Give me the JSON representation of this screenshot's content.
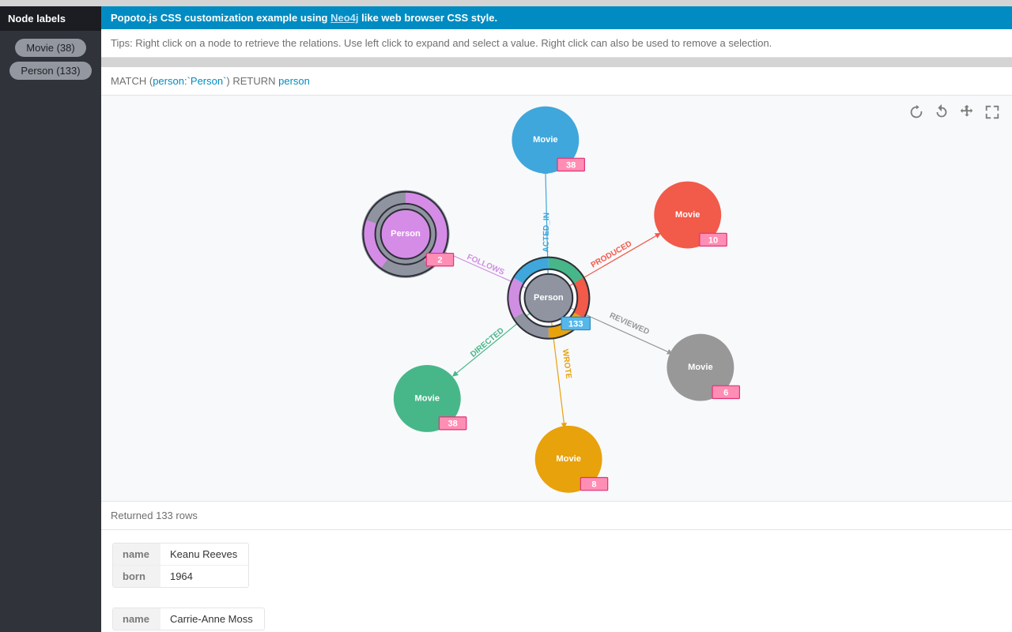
{
  "sidebar": {
    "header": "Node labels",
    "items": [
      {
        "label": "Movie (38)"
      },
      {
        "label": "Person (133)"
      }
    ]
  },
  "header": {
    "prefix": "Popoto.js CSS customization example using ",
    "link_text": "Neo4j",
    "suffix": " like web browser CSS style."
  },
  "tips": "Tips: Right click on a node to retrieve the relations. Use left click to expand and select a value. Right click can also be used to remove a selection.",
  "query": {
    "match": "MATCH (",
    "node_expr": "person:`Person`",
    "return": ") RETURN ",
    "return_var": "person"
  },
  "graph": {
    "center_node": {
      "label": "Person",
      "count": "133"
    },
    "relations": [
      {
        "name": "ACTED_IN",
        "target_label": "Movie",
        "count": "38",
        "color": "#3fa7db"
      },
      {
        "name": "PRODUCED",
        "target_label": "Movie",
        "count": "10",
        "color": "#f25a4a"
      },
      {
        "name": "REVIEWED",
        "target_label": "Movie",
        "count": "6",
        "color": "#989898"
      },
      {
        "name": "WROTE",
        "target_label": "Movie",
        "count": "8",
        "color": "#e8a20c"
      },
      {
        "name": "DIRECTED",
        "target_label": "Movie",
        "count": "38",
        "color": "#47b789"
      },
      {
        "name": "FOLLOWS",
        "target_label": "Person",
        "count": "2",
        "color": "#cf8ee1"
      }
    ]
  },
  "results": {
    "header": "Returned 133 rows",
    "rows": [
      {
        "name": "Keanu Reeves",
        "born": "1964"
      },
      {
        "name": "Carrie-Anne Moss"
      }
    ],
    "keys": {
      "name": "name",
      "born": "born"
    }
  }
}
